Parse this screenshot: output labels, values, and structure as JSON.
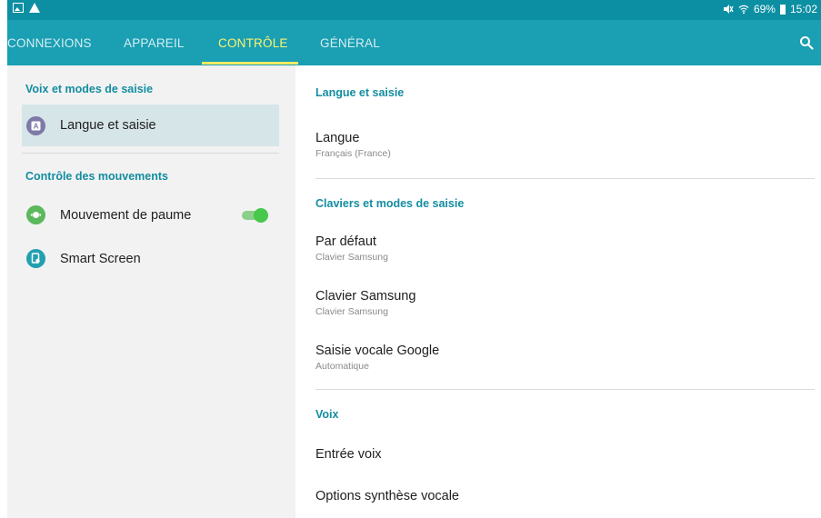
{
  "status_bar": {
    "left_icons": [
      "image-icon",
      "warning-icon"
    ],
    "right_icons": [
      "mute-icon",
      "wifi-icon"
    ],
    "battery_text": "69%",
    "time": "15:02"
  },
  "tabs": [
    {
      "label": "CONNEXIONS",
      "active": false
    },
    {
      "label": "APPAREIL",
      "active": false
    },
    {
      "label": "CONTRÔLE",
      "active": true
    },
    {
      "label": "GÉNÉRAL",
      "active": false
    }
  ],
  "left_pane": {
    "section1": "Voix et modes de saisie",
    "item_langue": "Langue et saisie",
    "section2": "Contrôle des mouvements",
    "item_paume": "Mouvement de paume",
    "item_paume_toggle": "on",
    "item_smart": "Smart Screen"
  },
  "right_pane": {
    "header1": "Langue et saisie",
    "langue_title": "Langue",
    "langue_sub": "Français (France)",
    "header2": "Claviers et modes de saisie",
    "defaut_title": "Par défaut",
    "defaut_sub": "Clavier Samsung",
    "clavier_title": "Clavier Samsung",
    "clavier_sub": "Clavier Samsung",
    "google_title": "Saisie vocale Google",
    "google_sub": "Automatique",
    "header3": "Voix",
    "entree_title": "Entrée voix",
    "synth_title": "Options synthèse vocale"
  },
  "colors": {
    "tabbar": "#1a9fb3",
    "statusbar": "#0d8fa3",
    "active_tab": "#fff36b",
    "section_header": "#138da0",
    "selected_item": "#d6e5e8",
    "toggle_on": "#47c84a"
  }
}
